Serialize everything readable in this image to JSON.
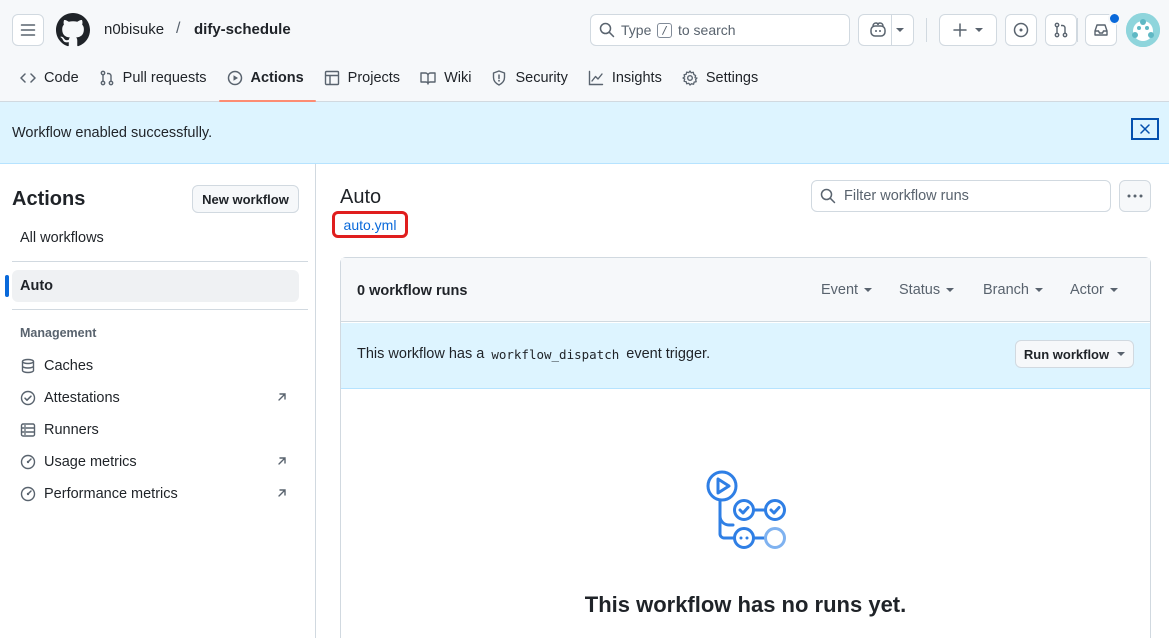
{
  "header": {
    "owner": "n0bisuke",
    "separator": "/",
    "repo": "dify-schedule",
    "search_prefix": "Type",
    "search_key": "/",
    "search_suffix": "to search"
  },
  "tabs": [
    {
      "label": "Code",
      "icon": "code-icon"
    },
    {
      "label": "Pull requests",
      "icon": "pull-request-icon"
    },
    {
      "label": "Actions",
      "icon": "play-icon",
      "active": true
    },
    {
      "label": "Projects",
      "icon": "table-icon"
    },
    {
      "label": "Wiki",
      "icon": "book-icon"
    },
    {
      "label": "Security",
      "icon": "shield-icon"
    },
    {
      "label": "Insights",
      "icon": "graph-icon"
    },
    {
      "label": "Settings",
      "icon": "gear-icon"
    }
  ],
  "flash": {
    "message": "Workflow enabled successfully."
  },
  "sidebar": {
    "title": "Actions",
    "new_workflow": "New workflow",
    "all_workflows": "All workflows",
    "selected": "Auto",
    "management_heading": "Management",
    "items": [
      {
        "label": "Caches",
        "external": false
      },
      {
        "label": "Attestations",
        "external": true
      },
      {
        "label": "Runners",
        "external": false
      },
      {
        "label": "Usage metrics",
        "external": true
      },
      {
        "label": "Performance metrics",
        "external": true
      }
    ]
  },
  "main": {
    "title": "Auto",
    "file": "auto.yml",
    "filter_placeholder": "Filter workflow runs",
    "runs_count": "0 workflow runs",
    "filters": [
      "Event",
      "Status",
      "Branch",
      "Actor"
    ],
    "dispatch_prefix": "This workflow has a",
    "dispatch_code": "workflow_dispatch",
    "dispatch_suffix": "event trigger.",
    "run_workflow": "Run workflow",
    "empty_title": "This workflow has no runs yet."
  },
  "colors": {
    "accent": "#0969da",
    "highlight_border": "#e01e1e",
    "active_tab_underline": "#fd8c73"
  }
}
